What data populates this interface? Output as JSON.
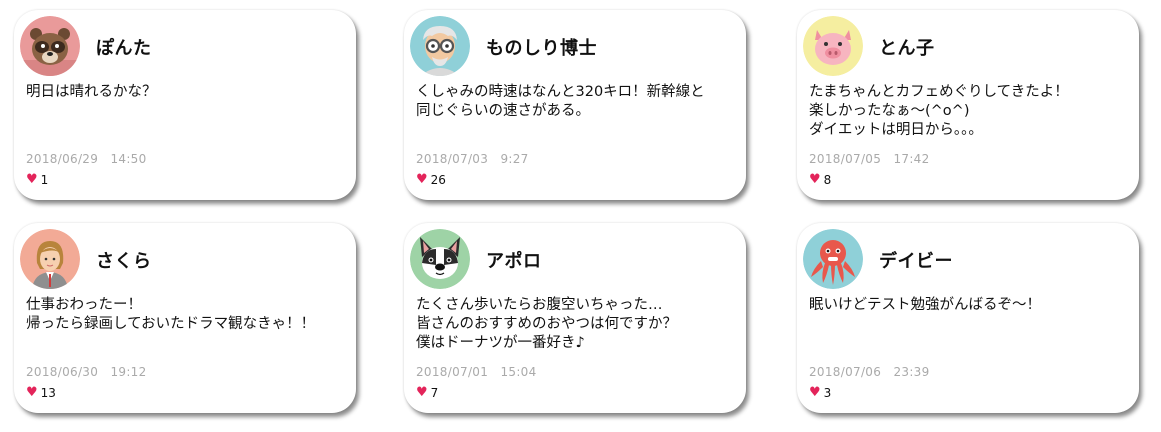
{
  "colors": {
    "heart": "#e3245a",
    "timestamp": "#aaaaaa"
  },
  "posts": [
    {
      "name": "ぽんた",
      "avatar_icon": "tanuki-icon",
      "avatar_bg": "#e99a9a",
      "text": "明日は晴れるかな？",
      "time": "2018/06/29　14:50",
      "likes": "1"
    },
    {
      "name": "ものしり博士",
      "avatar_icon": "professor-icon",
      "avatar_bg": "#8fd0d8",
      "text": "くしゃみの時速はなんと320キロ！新幹線と\n同じぐらいの速さがある。",
      "time": "2018/07/03　9:27",
      "likes": "26"
    },
    {
      "name": "とん子",
      "avatar_icon": "pig-icon",
      "avatar_bg": "#f5eea0",
      "text": "たまちゃんとカフェめぐりしてきたよ！\n楽しかったなぁ～(^o^)\nダイエットは明日から。。。",
      "time": "2018/07/05　17:42",
      "likes": "8"
    },
    {
      "name": "さくら",
      "avatar_icon": "woman-icon",
      "avatar_bg": "#f2aa96",
      "text": "仕事おわったー！\n帰ったら録画しておいたドラマ観なきゃ！！",
      "time": "2018/06/30　19:12",
      "likes": "13"
    },
    {
      "name": "アポロ",
      "avatar_icon": "dog-icon",
      "avatar_bg": "#9ed3a6",
      "text": "たくさん歩いたらお腹空いちゃった…\n皆さんのおすすめのおやつは何ですか？\n僕はドーナツが一番好き♪",
      "time": "2018/07/01　15:04",
      "likes": "7"
    },
    {
      "name": "デイビー",
      "avatar_icon": "octopus-icon",
      "avatar_bg": "#8fd0d8",
      "text": "眠いけどテスト勉強がんばるぞ～！",
      "time": "2018/07/06　23:39",
      "likes": "3"
    }
  ]
}
